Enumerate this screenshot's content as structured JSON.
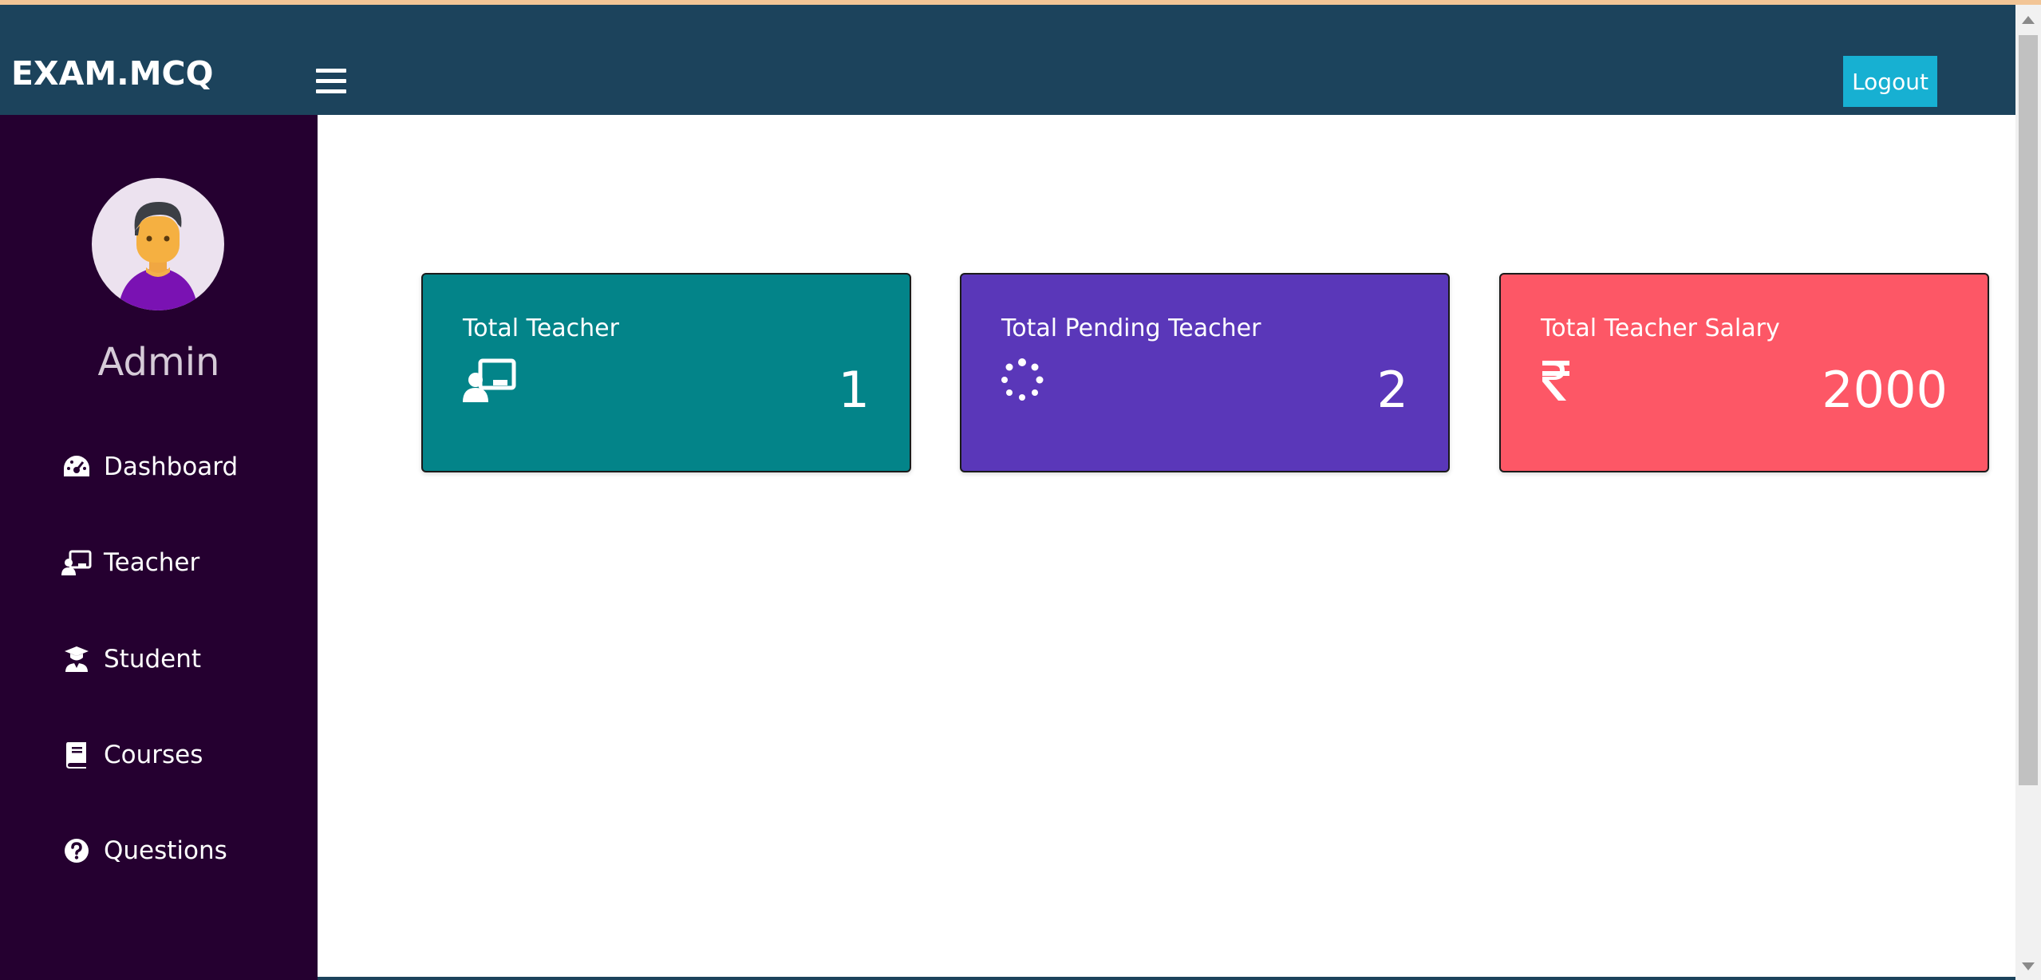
{
  "brand": "EXAM.MCQ",
  "header": {
    "logout_label": "Logout"
  },
  "sidebar": {
    "user_name": "Admin",
    "items": [
      {
        "label": "Dashboard",
        "icon": "tachometer-icon"
      },
      {
        "label": "Teacher",
        "icon": "chalkboard-teacher-icon"
      },
      {
        "label": "Student",
        "icon": "user-graduate-icon"
      },
      {
        "label": "Courses",
        "icon": "book-icon"
      },
      {
        "label": "Questions",
        "icon": "question-circle-icon"
      }
    ]
  },
  "cards": [
    {
      "title": "Total Teacher",
      "value": "1",
      "icon": "chalkboard-teacher-icon",
      "color": "#038489"
    },
    {
      "title": "Total Pending Teacher",
      "value": "2",
      "icon": "spinner-icon",
      "color": "#5a37b9"
    },
    {
      "title": "Total Teacher Salary",
      "value": "2000",
      "icon": "rupee-icon",
      "color": "#fd5766"
    }
  ],
  "colors": {
    "navbar": "#1c435c",
    "sidebar": "#250030",
    "logout_button": "#17b0d2"
  }
}
